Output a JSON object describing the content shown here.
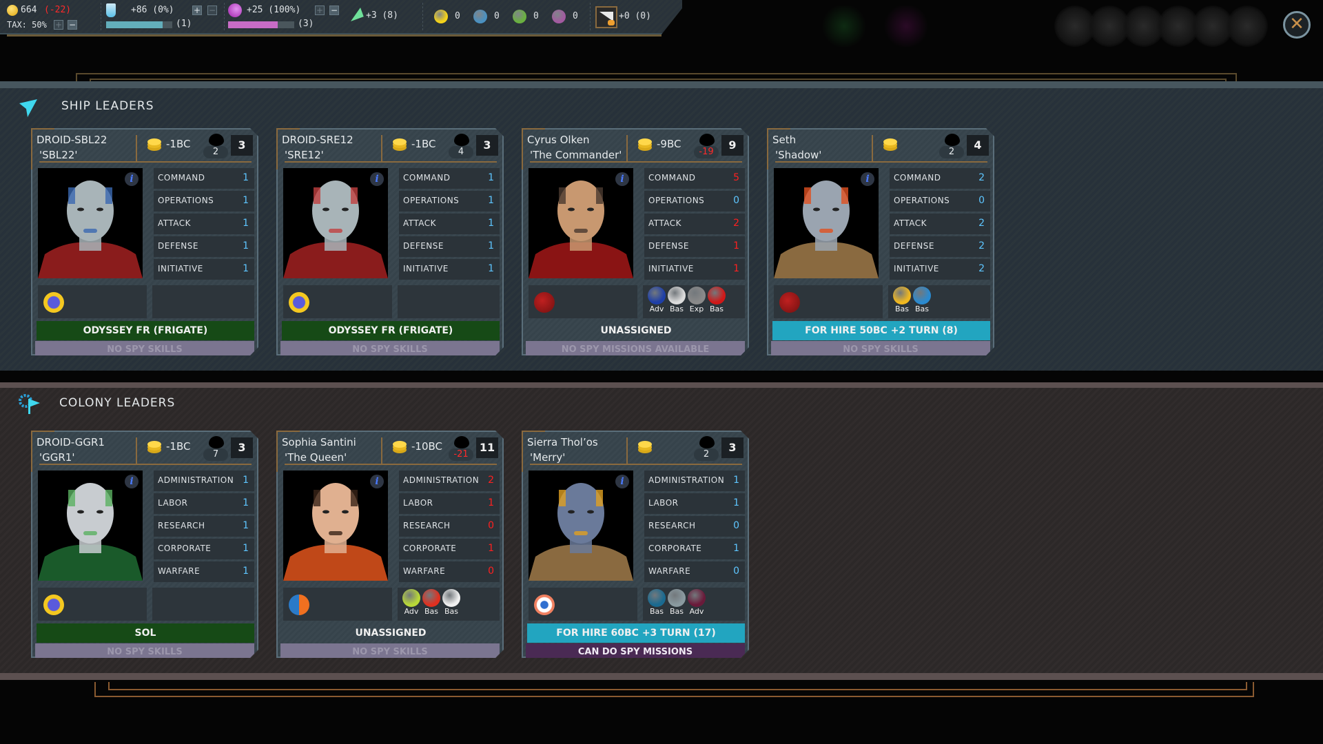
{
  "topbar": {
    "credits": "664",
    "credits_delta": "(-22)",
    "tax": "TAX: 50%",
    "research": "+86 (0%)",
    "research_queue": "(1)",
    "research_progress": 0.85,
    "influence": "+25 (100%)",
    "influence_queue": "(3)",
    "influence_progress": 0.75,
    "command": "+3 (8)",
    "resources": [
      {
        "name": "antimatter",
        "value": "0",
        "color": "#f4d21a"
      },
      {
        "name": "exotic-crystal",
        "value": "0",
        "color": "#4a90c0"
      },
      {
        "name": "gem",
        "value": "0",
        "color": "#6ab040"
      },
      {
        "name": "molecule",
        "value": "0",
        "color": "#a35aa0"
      }
    ],
    "ship_production": "+0 (0)"
  },
  "ship_section": {
    "title": "SHIP LEADERS",
    "cards": [
      {
        "name": "DROID-SBL22",
        "nickname": "'SBL22'",
        "upkeep": "-1BC",
        "bubble": "2",
        "bubble_negative": false,
        "level": "3",
        "portrait": "droid-blue",
        "stats": [
          {
            "label": "COMMAND",
            "value": "1",
            "color": "blue"
          },
          {
            "label": "OPERATIONS",
            "value": "1",
            "color": "blue"
          },
          {
            "label": "ATTACK",
            "value": "1",
            "color": "blue"
          },
          {
            "label": "DEFENSE",
            "value": "1",
            "color": "blue"
          },
          {
            "label": "INITIATIVE",
            "value": "1",
            "color": "blue"
          }
        ],
        "trait": "robot-icon",
        "skills": [],
        "assignment": "ODYSSEY FR (FRIGATE)",
        "assignment_style": "green",
        "spy": "NO SPY SKILLS",
        "spy_style": "gray"
      },
      {
        "name": "DROID-SRE12",
        "nickname": "'SRE12'",
        "upkeep": "-1BC",
        "bubble": "4",
        "bubble_negative": false,
        "level": "3",
        "portrait": "droid-red",
        "stats": [
          {
            "label": "COMMAND",
            "value": "1",
            "color": "blue"
          },
          {
            "label": "OPERATIONS",
            "value": "1",
            "color": "blue"
          },
          {
            "label": "ATTACK",
            "value": "1",
            "color": "blue"
          },
          {
            "label": "DEFENSE",
            "value": "1",
            "color": "blue"
          },
          {
            "label": "INITIATIVE",
            "value": "1",
            "color": "blue"
          }
        ],
        "trait": "robot-icon",
        "skills": [],
        "assignment": "ODYSSEY FR (FRIGATE)",
        "assignment_style": "green",
        "spy": "NO SPY SKILLS",
        "spy_style": "gray"
      },
      {
        "name": "Cyrus Olken",
        "nickname": "'The Commander'",
        "upkeep": "-9BC",
        "bubble": "-19",
        "bubble_negative": true,
        "level": "9",
        "portrait": "human-bald",
        "stats": [
          {
            "label": "COMMAND",
            "value": "5",
            "color": "red"
          },
          {
            "label": "OPERATIONS",
            "value": "0",
            "color": "blue"
          },
          {
            "label": "ATTACK",
            "value": "2",
            "color": "red"
          },
          {
            "label": "DEFENSE",
            "value": "1",
            "color": "red"
          },
          {
            "label": "INITIATIVE",
            "value": "1",
            "color": "red"
          }
        ],
        "trait": "wolf-icon",
        "skills": [
          {
            "label": "Adv",
            "icon": "constellation-icon",
            "color": "#1e3fa8"
          },
          {
            "label": "Bas",
            "icon": "swap-icon",
            "color": "#dcdcdc"
          },
          {
            "label": "Exp",
            "icon": "rocket-plus-icon",
            "color": "#8a8a8a"
          },
          {
            "label": "Bas",
            "icon": "bomb-icon",
            "color": "#d01818"
          }
        ],
        "assignment": "UNASSIGNED",
        "assignment_style": "plain",
        "spy": "NO SPY MISSIONS AVAILABLE",
        "spy_style": "gray"
      },
      {
        "name": "Seth",
        "nickname": "'Shadow'",
        "upkeep": "",
        "bubble": "2",
        "bubble_negative": false,
        "level": "4",
        "portrait": "helmet",
        "stats": [
          {
            "label": "COMMAND",
            "value": "2",
            "color": "blue"
          },
          {
            "label": "OPERATIONS",
            "value": "0",
            "color": "blue"
          },
          {
            "label": "ATTACK",
            "value": "2",
            "color": "blue"
          },
          {
            "label": "DEFENSE",
            "value": "2",
            "color": "blue"
          },
          {
            "label": "INITIATIVE",
            "value": "2",
            "color": "blue"
          }
        ],
        "trait": "wolf-icon",
        "skills": [
          {
            "label": "Bas",
            "icon": "rank-star-icon",
            "color": "#f0b820"
          },
          {
            "label": "Bas",
            "icon": "radar-icon",
            "color": "#2a8ad0"
          }
        ],
        "assignment": "FOR HIRE 50BC +2 TURN (8)",
        "assignment_style": "cyan",
        "spy": "NO SPY SKILLS",
        "spy_style": "gray"
      }
    ]
  },
  "colony_section": {
    "title": "COLONY LEADERS",
    "cards": [
      {
        "name": "DROID-GGR1",
        "nickname": "'GGR1'",
        "upkeep": "-1BC",
        "bubble": "7",
        "bubble_negative": false,
        "level": "3",
        "portrait": "droid-green",
        "stats": [
          {
            "label": "ADMINISTRATION",
            "value": "1",
            "color": "blue"
          },
          {
            "label": "LABOR",
            "value": "1",
            "color": "blue"
          },
          {
            "label": "RESEARCH",
            "value": "1",
            "color": "blue"
          },
          {
            "label": "CORPORATE",
            "value": "1",
            "color": "blue"
          },
          {
            "label": "WARFARE",
            "value": "1",
            "color": "blue"
          }
        ],
        "trait": "robot-icon",
        "skills": [],
        "assignment": "SOL",
        "assignment_style": "green",
        "spy": "NO SPY SKILLS",
        "spy_style": "gray"
      },
      {
        "name": "Sophia Santini",
        "nickname": "'The Queen'",
        "upkeep": "-10BC",
        "bubble": "-21",
        "bubble_negative": true,
        "level": "11",
        "portrait": "human-woman",
        "stats": [
          {
            "label": "ADMINISTRATION",
            "value": "2",
            "color": "red"
          },
          {
            "label": "LABOR",
            "value": "1",
            "color": "red"
          },
          {
            "label": "RESEARCH",
            "value": "0",
            "color": "red"
          },
          {
            "label": "CORPORATE",
            "value": "1",
            "color": "red"
          },
          {
            "label": "WARFARE",
            "value": "0",
            "color": "red"
          }
        ],
        "trait": "circuit-icon",
        "skills": [
          {
            "label": "Adv",
            "icon": "flask-chart-icon",
            "color": "#b8d838"
          },
          {
            "label": "Bas",
            "icon": "crowd-icon",
            "color": "#e03020"
          },
          {
            "label": "Bas",
            "icon": "medical-cross-icon",
            "color": "#f0f0f0"
          }
        ],
        "assignment": "UNASSIGNED",
        "assignment_style": "plain",
        "spy": "NO SPY SKILLS",
        "spy_style": "gray"
      },
      {
        "name": "Sierra Thol’os",
        "nickname": "'Merry'",
        "upkeep": "",
        "bubble": "2",
        "bubble_negative": false,
        "level": "3",
        "portrait": "alien-mask",
        "stats": [
          {
            "label": "ADMINISTRATION",
            "value": "1",
            "color": "blue"
          },
          {
            "label": "LABOR",
            "value": "1",
            "color": "blue"
          },
          {
            "label": "RESEARCH",
            "value": "0",
            "color": "blue"
          },
          {
            "label": "CORPORATE",
            "value": "1",
            "color": "blue"
          },
          {
            "label": "WARFARE",
            "value": "0",
            "color": "blue"
          }
        ],
        "trait": "eye-icon",
        "skills": [
          {
            "label": "Bas",
            "icon": "megaphone-icon",
            "color": "#1a6a90"
          },
          {
            "label": "Bas",
            "icon": "factory-thumb-icon",
            "color": "#8a9aa0"
          },
          {
            "label": "Adv",
            "icon": "lightning-icon",
            "color": "#6a1a3a"
          }
        ],
        "assignment": "FOR HIRE 60BC +3 TURN (17)",
        "assignment_style": "cyan",
        "spy": "CAN DO SPY MISSIONS",
        "spy_style": "purple"
      }
    ]
  }
}
